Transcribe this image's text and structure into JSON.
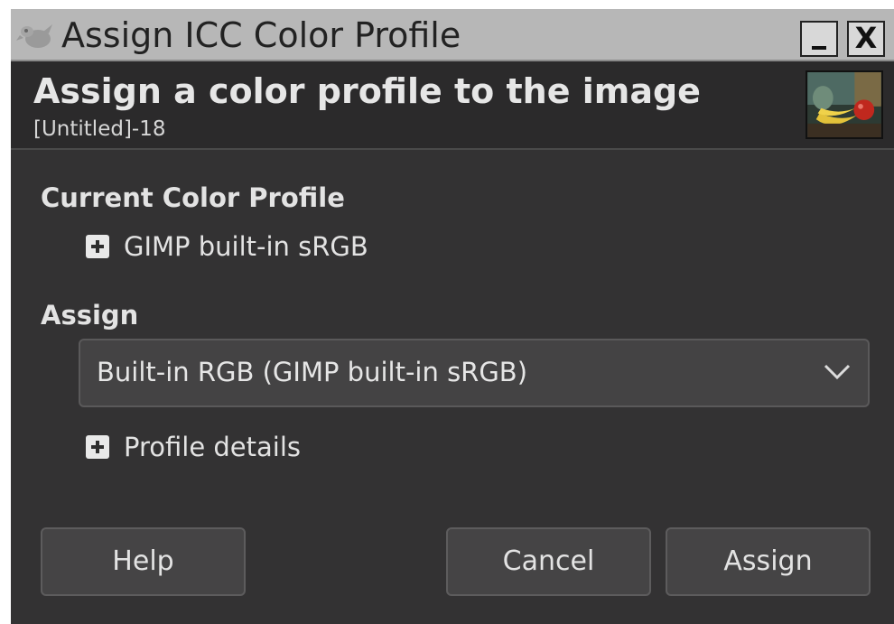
{
  "window": {
    "title": "Assign ICC Color Profile",
    "controls": {
      "minimize": "_",
      "close": "X"
    }
  },
  "header": {
    "title": "Assign a color profile to the image",
    "subtitle": "[Untitled]-18"
  },
  "current_profile": {
    "section_label": "Current Color Profile",
    "profile_name": "GIMP built-in sRGB"
  },
  "assign": {
    "section_label": "Assign",
    "selected_profile": "Built-in RGB (GIMP built-in sRGB)",
    "details_label": "Profile details"
  },
  "buttons": {
    "help": "Help",
    "cancel": "Cancel",
    "assign": "Assign"
  },
  "icons": [
    "gimp-wilber-icon",
    "image-thumbnail",
    "expander-plus-icon",
    "chevron-down-icon"
  ],
  "colors": {
    "dialog_bg": "#333233",
    "titlebar_bg": "#b7b7b7",
    "text": "#e3e3e3"
  }
}
